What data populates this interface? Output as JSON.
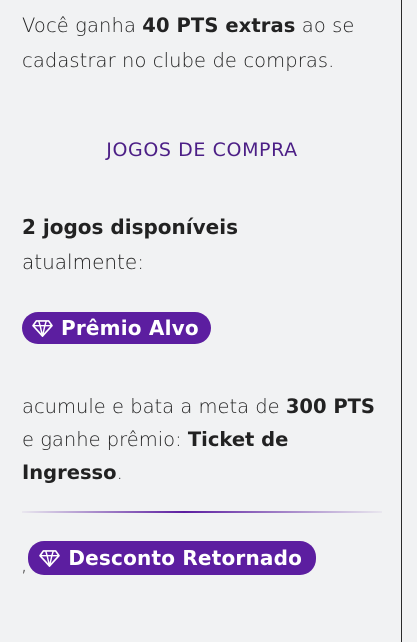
{
  "intro": {
    "part1": "Você ganha ",
    "bold": "40 PTS extras",
    "part2": " ao se cadastrar no clube de compras."
  },
  "section_title": "JOGOS DE COMPRA",
  "games": {
    "count_label": "2 jogos disponíveis",
    "suffix": "atualmente:"
  },
  "game1": {
    "icon": "gem-icon",
    "label": "Prêmio Alvo",
    "desc_part1": "acumule e bata a meta de ",
    "desc_bold1": "300 PTS",
    "desc_part2": " e ganhe prêmio: ",
    "desc_bold2": "Ticket de Ingresso",
    "desc_part3": "."
  },
  "separator": ",",
  "game2": {
    "icon": "gem-icon",
    "label": "Desconto Retornado"
  },
  "colors": {
    "accent": "#5c1ea0",
    "title": "#4c1f86",
    "background": "#f1f2f3"
  }
}
